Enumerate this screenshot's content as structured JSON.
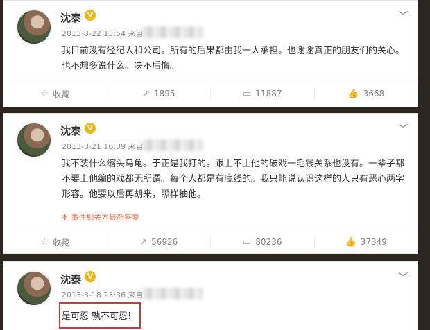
{
  "posts": [
    {
      "author": "沈泰",
      "badge": "V",
      "meta": "2013-3-22 13:54 来自",
      "text": "我目前没有经纪人和公司。所有的后果都由我一人承担。也谢谢真正的朋友们的关心。也不想多说什么。决不后悔。",
      "actions": {
        "fav": "收藏",
        "repost": "1895",
        "comment": "11887",
        "like": "3668"
      }
    },
    {
      "author": "沈泰",
      "badge": "V",
      "meta": "2013-3-21 16:39 来自",
      "text": "我不装什么缩头乌龟。于正是我打的。跟上不上他的破戏一毛钱关系也没有。一辈子都不要上他编的戏都无所谓。每个人都是有底线的。我只能说认识这样的人只有恶心两字形容。他要以后再胡来，照样抽他。",
      "related": "事件相关方最新答复",
      "actions": {
        "fav": "收藏",
        "repost": "56926",
        "comment": "80236",
        "like": "37349"
      }
    },
    {
      "author": "沈泰",
      "badge": "V",
      "meta": "2013-3-18 23:36 来自",
      "text": "是可忍 孰不可忍!"
    }
  ],
  "icons": {
    "more": "chevron-down-icon",
    "fav": "star-icon",
    "repost": "repost-icon",
    "comment": "comment-icon",
    "like": "thumbs-up-icon"
  },
  "colors": {
    "accent": "#eb7350",
    "highlight_box": "#d93333",
    "badge": "#f6b400"
  }
}
